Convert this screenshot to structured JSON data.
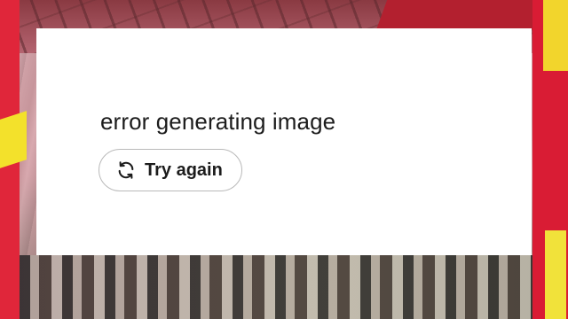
{
  "error_card": {
    "message": "error generating image",
    "retry_button": {
      "label": "Try again",
      "icon": "refresh-icon"
    }
  },
  "colors": {
    "card_background": "#ffffff",
    "text": "#1c1c1c",
    "button_border": "#b9b9b9",
    "frame_red": "#e0263a",
    "frame_yellow": "#f3e12b"
  }
}
